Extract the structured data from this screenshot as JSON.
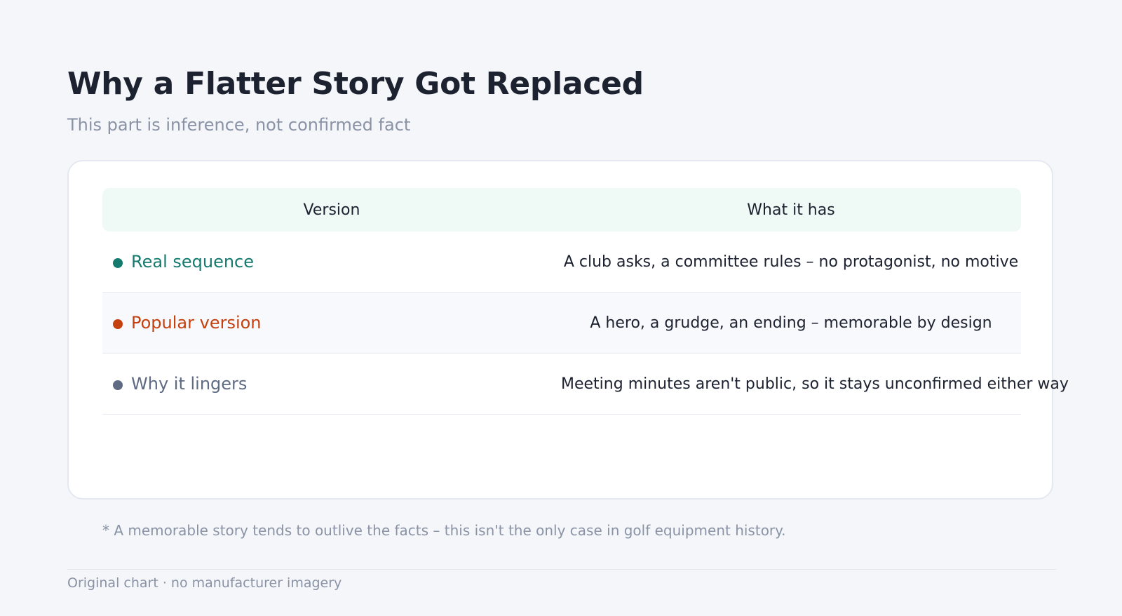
{
  "header": {
    "title": "Why a Flatter Story Got Replaced",
    "subtitle": "This part is inference, not confirmed fact"
  },
  "table": {
    "columns": [
      "Version",
      "What it has"
    ],
    "rows": [
      {
        "version": "Real sequence",
        "what_it_has": "A club asks, a committee rules – no protagonist, no motive",
        "color": "#157a6e"
      },
      {
        "version": "Popular version",
        "what_it_has": "A hero, a grudge, an ending – memorable by design",
        "color": "#c4410f"
      },
      {
        "version": "Why it lingers",
        "what_it_has": "Meeting minutes aren't public, so it stays unconfirmed either way",
        "color": "#5e6b82"
      }
    ]
  },
  "footnote": "* A memorable story tends to outlive the facts – this isn't the only case in golf equipment history.",
  "credit": "Original chart · no manufacturer imagery"
}
